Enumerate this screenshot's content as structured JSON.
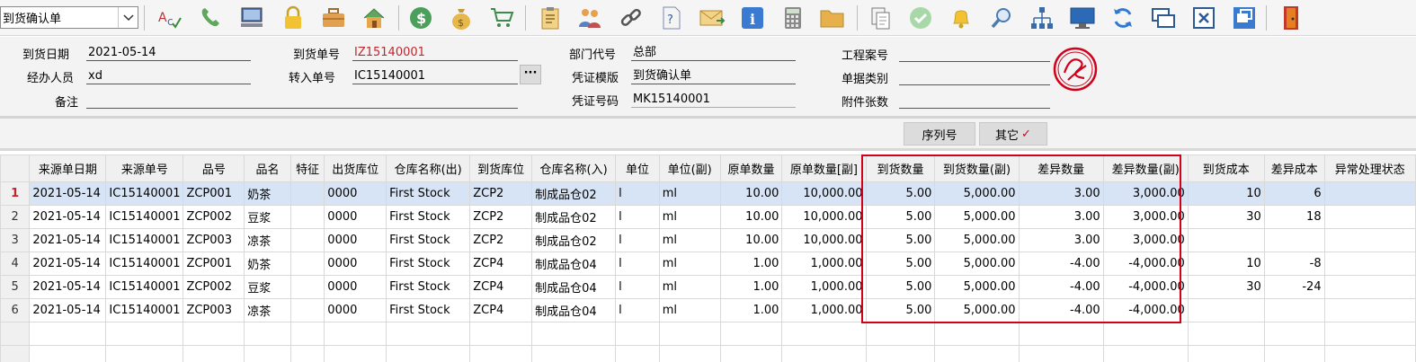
{
  "toolbar": {
    "doc_type_value": "到货确认单",
    "icons": [
      "spellcheck-icon",
      "phone-icon",
      "computer-icon",
      "lock-icon",
      "briefcase-icon",
      "home-icon",
      "dollar-icon",
      "money-bag-icon",
      "cart-icon",
      "clipboard-icon",
      "users-icon",
      "link-icon",
      "help-doc-icon",
      "mail-icon",
      "info-icon",
      "calculator-icon",
      "folder-icon",
      "copy-icon",
      "check-icon",
      "bell-icon",
      "search-icon",
      "org-chart-icon",
      "monitor-icon",
      "refresh-icon",
      "windows-icon",
      "close-icon",
      "restore-icon",
      "exit-door-icon"
    ]
  },
  "form": {
    "arrival_date_label": "到货日期",
    "arrival_date": "2021-05-14",
    "arrival_no_label": "到货单号",
    "arrival_no": "IZ15140001",
    "dept_code_label": "部门代号",
    "dept_code": "总部",
    "project_no_label": "工程案号",
    "project_no": "",
    "handler_label": "经办人员",
    "handler": "xd",
    "transfer_no_label": "转入单号",
    "transfer_no": "IC15140001",
    "voucher_template_label": "凭证模版",
    "voucher_template": "到货确认单",
    "doc_category_label": "单据类别",
    "doc_category": "",
    "note_label": "备注",
    "note": "",
    "voucher_no_label": "凭证号码",
    "voucher_no": "MK15140001",
    "attachments_label": "附件张数",
    "attachments": "",
    "ellipsis": "···"
  },
  "tabs": {
    "serial_label": "序列号",
    "other_label": "其它",
    "other_check": "✓"
  },
  "grid": {
    "headers": [
      "",
      "来源单日期",
      "来源单号",
      "品号",
      "品名",
      "特征",
      "出货库位",
      "仓库名称(出)",
      "到货库位",
      "仓库名称(入)",
      "单位",
      "单位(副)",
      "原单数量",
      "原单数量[副]",
      "到货数量",
      "到货数量(副)",
      "差异数量",
      "差异数量(副)",
      "到货成本",
      "差异成本",
      "异常处理状态"
    ],
    "rows": [
      [
        "1",
        "2021-05-14",
        "IC15140001",
        "ZCP001",
        "奶茶",
        "",
        "0000",
        "First Stock",
        "ZCP2",
        "制成品仓02",
        "l",
        "ml",
        "10.00",
        "10,000.00",
        "5.00",
        "5,000.00",
        "3.00",
        "3,000.00",
        "10",
        "6",
        ""
      ],
      [
        "2",
        "2021-05-14",
        "IC15140001",
        "ZCP002",
        "豆浆",
        "",
        "0000",
        "First Stock",
        "ZCP2",
        "制成品仓02",
        "l",
        "ml",
        "10.00",
        "10,000.00",
        "5.00",
        "5,000.00",
        "3.00",
        "3,000.00",
        "30",
        "18",
        ""
      ],
      [
        "3",
        "2021-05-14",
        "IC15140001",
        "ZCP003",
        "凉茶",
        "",
        "0000",
        "First Stock",
        "ZCP2",
        "制成品仓02",
        "l",
        "ml",
        "10.00",
        "10,000.00",
        "5.00",
        "5,000.00",
        "3.00",
        "3,000.00",
        "",
        "",
        ""
      ],
      [
        "4",
        "2021-05-14",
        "IC15140001",
        "ZCP001",
        "奶茶",
        "",
        "0000",
        "First Stock",
        "ZCP4",
        "制成品仓04",
        "l",
        "ml",
        "1.00",
        "1,000.00",
        "5.00",
        "5,000.00",
        "-4.00",
        "-4,000.00",
        "10",
        "-8",
        ""
      ],
      [
        "5",
        "2021-05-14",
        "IC15140001",
        "ZCP002",
        "豆浆",
        "",
        "0000",
        "First Stock",
        "ZCP4",
        "制成品仓04",
        "l",
        "ml",
        "1.00",
        "1,000.00",
        "5.00",
        "5,000.00",
        "-4.00",
        "-4,000.00",
        "30",
        "-24",
        ""
      ],
      [
        "6",
        "2021-05-14",
        "IC15140001",
        "ZCP003",
        "凉茶",
        "",
        "0000",
        "First Stock",
        "ZCP4",
        "制成品仓04",
        "l",
        "ml",
        "1.00",
        "1,000.00",
        "5.00",
        "5,000.00",
        "-4.00",
        "-4,000.00",
        "",
        "",
        ""
      ]
    ]
  },
  "colors": {
    "accent_red": "#d0021b",
    "selected_row": "#d7e4f5"
  }
}
